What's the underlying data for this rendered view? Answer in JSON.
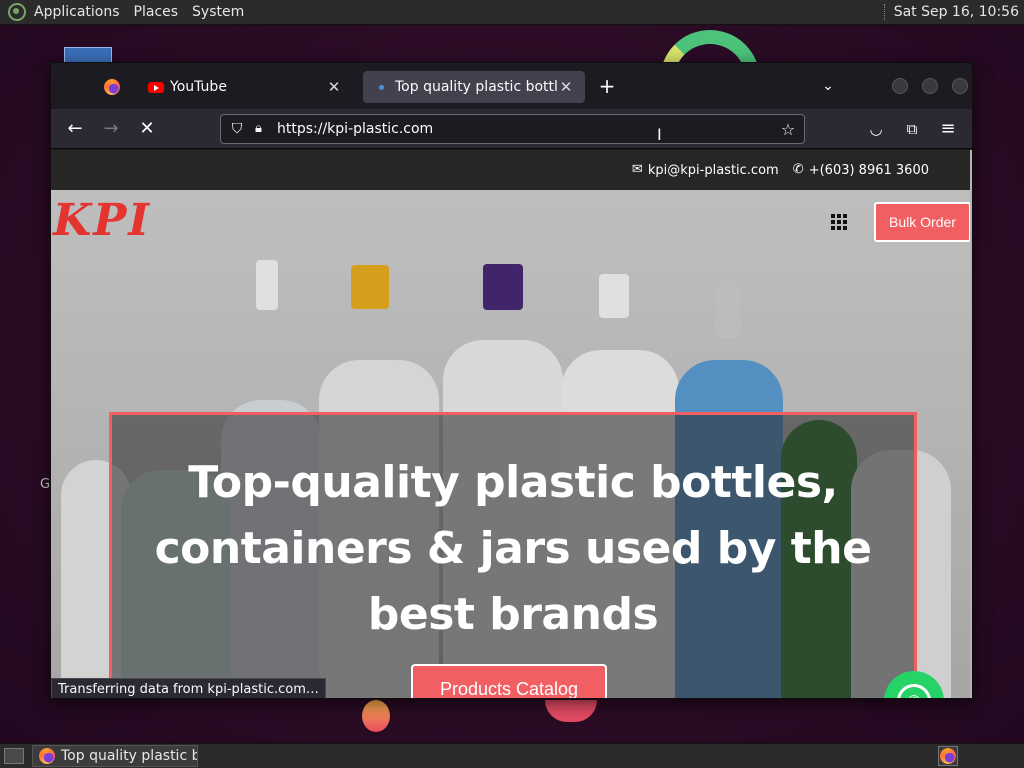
{
  "top_panel": {
    "menus": [
      "Applications",
      "Places",
      "System"
    ],
    "clock": "Sat Sep 16, 10:56"
  },
  "browser": {
    "tabs": [
      {
        "title": "YouTube",
        "icon": "youtube-icon"
      },
      {
        "title": "Top quality plastic bottles m",
        "icon": "loading-dot-icon",
        "active": true
      }
    ],
    "url": "https://kpi-plastic.com"
  },
  "site": {
    "email": "kpi@kpi-plastic.com",
    "phone": "+(603) 8961 3600",
    "logo_text": "KPI",
    "bulk_order_label": "Bulk Order",
    "hero_line1": "Top-quality plastic bottles,",
    "hero_line2": "containers & jars used by the",
    "hero_line3": "best brands",
    "catalog_label": "Products Catalog",
    "accent": "#f15f63"
  },
  "status_text": "Transferring data from kpi-plastic.com…",
  "taskbar": {
    "task_label": "Top quality plastic b…"
  },
  "desktop": {
    "partial_letter": "G"
  }
}
